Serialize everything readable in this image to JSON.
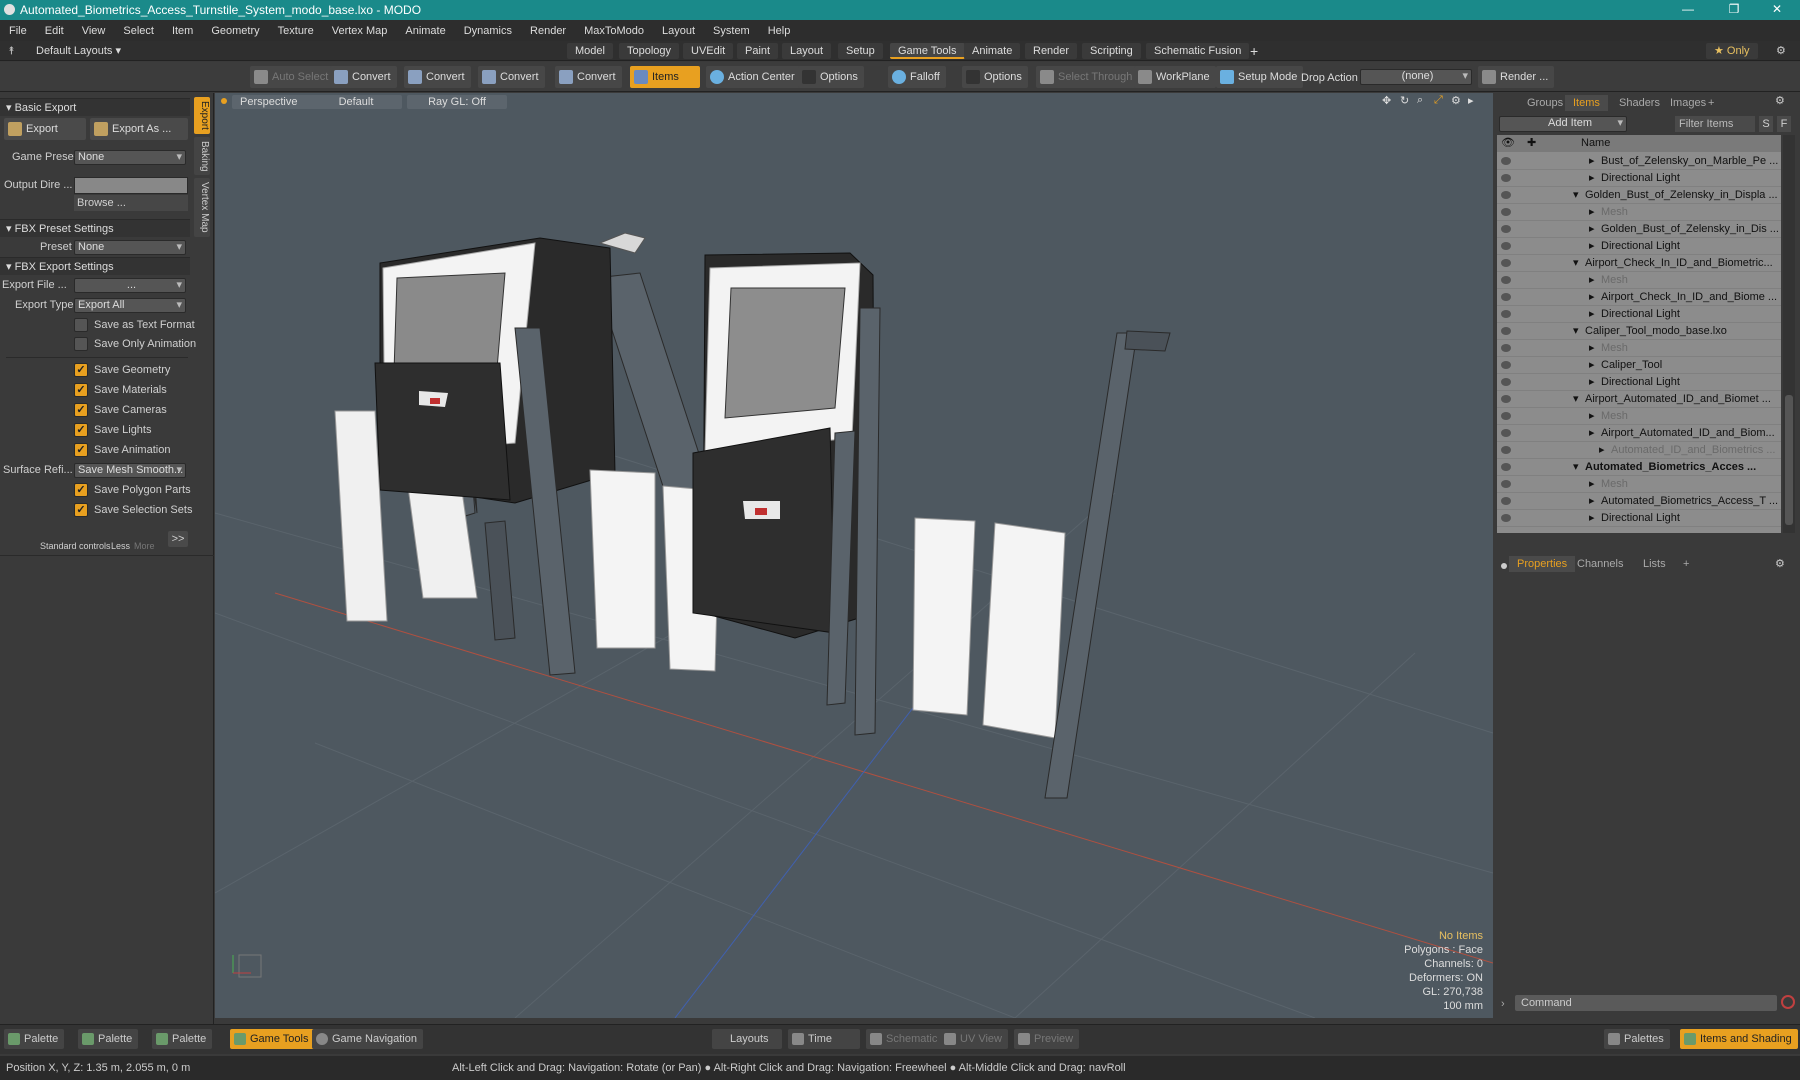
{
  "window": {
    "title": "Automated_Biometrics_Access_Turnstile_System_modo_base.lxo - MODO"
  },
  "menu": [
    "File",
    "Edit",
    "View",
    "Select",
    "Item",
    "Geometry",
    "Texture",
    "Vertex Map",
    "Animate",
    "Dynamics",
    "Render",
    "MaxToModo",
    "Layout",
    "System",
    "Help"
  ],
  "layouts": {
    "default": "Default Layouts ▾",
    "tabs": [
      "Model",
      "Topology",
      "UVEdit",
      "Paint",
      "Layout",
      "Setup",
      "Game Tools",
      "Animate",
      "Render",
      "Scripting",
      "Schematic Fusion"
    ],
    "add": "+",
    "only": "★ Only"
  },
  "toolbar": {
    "auto_select": "Auto Select",
    "convert": "Convert",
    "items": "Items",
    "action_center": "Action Center",
    "options": "Options",
    "falloff": "Falloff",
    "select_through": "Select Through",
    "workplane": "WorkPlane",
    "setup_mode": "Setup Mode",
    "drop_action": "Drop Action",
    "drop_value": "(none)",
    "render": "Render ..."
  },
  "left": {
    "basic_export": "Basic Export",
    "export": "Export",
    "export_as": "Export As ...",
    "game_preset_label": "Game Preset",
    "game_preset": "None",
    "output_dir_label": "Output Dire ...",
    "browse": "Browse ...",
    "fbx_preset": "FBX Preset Settings",
    "preset_label": "Preset",
    "preset": "None",
    "fbx_export": "FBX Export Settings",
    "export_file_label": "Export File  ...",
    "export_file": "...",
    "export_type_label": "Export Type",
    "export_type": "Export All",
    "save_text": "Save as Text Format",
    "save_only_anim": "Save Only Animation",
    "checks": [
      "Save Geometry",
      "Save Materials",
      "Save Cameras",
      "Save Lights",
      "Save Animation"
    ],
    "surface_label": "Surface Refi...",
    "surface": "Save Mesh Smooth...",
    "checks2": [
      "Save Polygon Parts",
      "Save Selection Sets"
    ],
    "std": "Standard controls",
    "less": "Less",
    "more": "More",
    "more_btn": ">>"
  },
  "vtabs": [
    "Export",
    "Baking",
    "Vertex Map"
  ],
  "viewport": {
    "perspective": "Perspective",
    "default": "Default",
    "raygl": "Ray GL: Off",
    "info": [
      "No Items",
      "Polygons : Face",
      "Channels: 0",
      "Deformers: ON",
      "GL: 270,738",
      "100 mm"
    ]
  },
  "right": {
    "tabs": [
      "Groups",
      "Items",
      "Shaders",
      "Images",
      "+"
    ],
    "add_item": "Add Item",
    "filter": "Filter Items",
    "s": "S",
    "f": "F",
    "name_col": "Name",
    "items": [
      {
        "name": "Bust_of_Zelensky_on_Marble_Pe ...",
        "indent": 3,
        "dim": false
      },
      {
        "name": "Directional Light",
        "indent": 3,
        "dim": false
      },
      {
        "name": "Golden_Bust_of_Zelensky_in_Displa ...",
        "indent": 1,
        "dim": false
      },
      {
        "name": "Mesh",
        "indent": 3,
        "dim": true
      },
      {
        "name": "Golden_Bust_of_Zelensky_in_Dis ...",
        "indent": 3,
        "dim": false
      },
      {
        "name": "Directional Light",
        "indent": 3,
        "dim": false
      },
      {
        "name": "Airport_Check_In_ID_and_Biometric...",
        "indent": 1,
        "dim": false
      },
      {
        "name": "Mesh",
        "indent": 3,
        "dim": true
      },
      {
        "name": "Airport_Check_In_ID_and_Biome ...",
        "indent": 3,
        "dim": false
      },
      {
        "name": "Directional Light",
        "indent": 3,
        "dim": false
      },
      {
        "name": "Caliper_Tool_modo_base.lxo",
        "indent": 1,
        "dim": false
      },
      {
        "name": "Mesh",
        "indent": 3,
        "dim": true
      },
      {
        "name": "Caliper_Tool",
        "indent": 3,
        "dim": false
      },
      {
        "name": "Directional Light",
        "indent": 3,
        "dim": false
      },
      {
        "name": "Airport_Automated_ID_and_Biomet ...",
        "indent": 1,
        "dim": false
      },
      {
        "name": "Mesh",
        "indent": 3,
        "dim": true
      },
      {
        "name": "Airport_Automated_ID_and_Biom...",
        "indent": 3,
        "dim": false
      },
      {
        "name": "Automated_ID_and_Biometrics ...",
        "indent": 4,
        "dim": true
      },
      {
        "name": "Automated_Biometrics_Acces ...",
        "indent": 1,
        "dim": false,
        "bold": true
      },
      {
        "name": "Mesh",
        "indent": 3,
        "dim": true
      },
      {
        "name": "Automated_Biometrics_Access_T ...",
        "indent": 3,
        "dim": false
      },
      {
        "name": "Directional Light",
        "indent": 3,
        "dim": false
      }
    ],
    "props_tabs": [
      "Properties",
      "Channels",
      "Lists",
      "+"
    ],
    "command": "Command"
  },
  "status": {
    "palette": "Palette",
    "game_tools": "Game Tools",
    "game_nav": "Game Navigation",
    "layouts": "Layouts",
    "time": "Time",
    "schematic": "Schematic",
    "uv_view": "UV View",
    "preview": "Preview",
    "palettes": "Palettes",
    "items_shading": "Items and Shading"
  },
  "info": {
    "position": "Position X, Y, Z:   1.35 m, 2.055 m, 0 m",
    "hint": "Alt-Left Click and Drag: Navigation: Rotate (or Pan) ● Alt-Right Click and Drag: Navigation: Freewheel ● Alt-Middle Click and Drag: navRoll"
  }
}
